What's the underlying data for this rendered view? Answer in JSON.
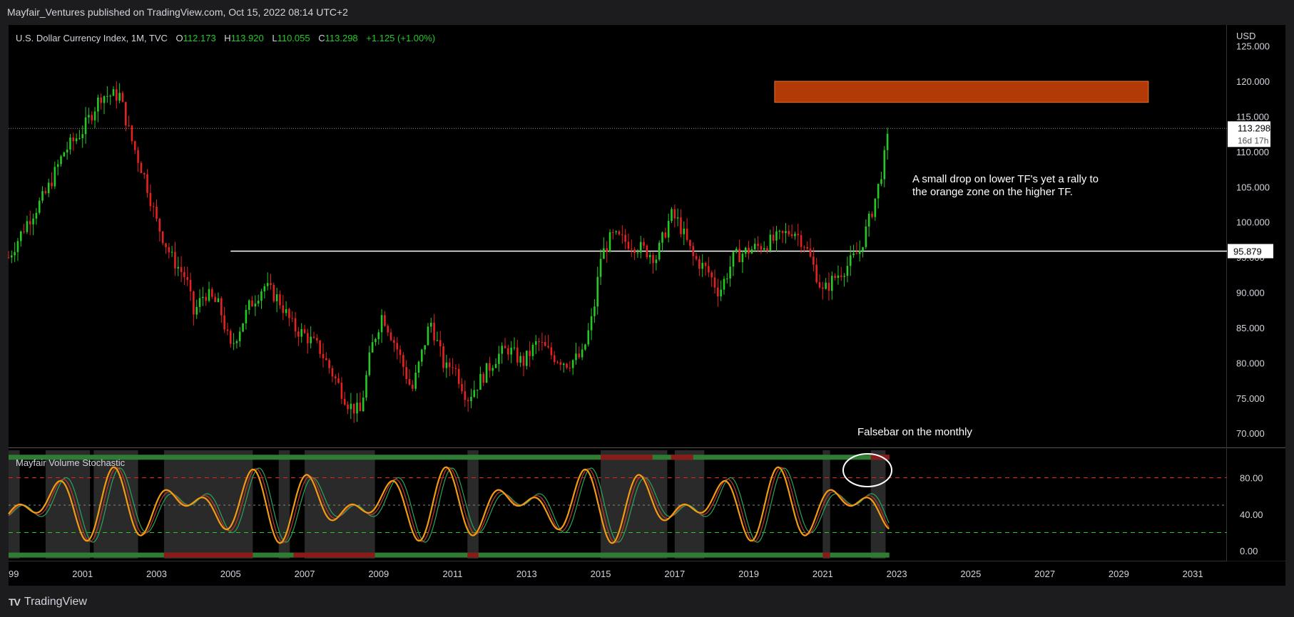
{
  "header": {
    "published": "Mayfair_Ventures published on TradingView.com, Oct 15, 2022 08:14 UTC+2"
  },
  "footer": {
    "brand": "TradingView",
    "logo": "tv-logo"
  },
  "symbol": {
    "name": "U.S. Dollar Currency Index, 1M, TVC",
    "o_label": "O",
    "o": "112.173",
    "h_label": "H",
    "h": "113.920",
    "l_label": "L",
    "l": "110.055",
    "c_label": "C",
    "c": "113.298",
    "change": "+1.125 (+1.00%)"
  },
  "price_axis": {
    "currency": "USD"
  },
  "annotations": {
    "note_line1": "A small drop on lower TF's yet a rally to",
    "note_line2": "the orange zone on the higher TF.",
    "falsebar": "Falsebar on the monthly",
    "level": "95.879",
    "last_price": "113.298",
    "countdown": "16d 17h"
  },
  "indicator": {
    "name": "Mayfair Volume Stochastic"
  },
  "colors": {
    "up": "#26c826",
    "down": "#e52222",
    "zone": "#b23a06",
    "stoch_fast": "#26a65b",
    "stoch_slow": "#c0392b",
    "stoch_ma": "#f39c12"
  },
  "chart_data": [
    {
      "type": "candlestick",
      "title": "U.S. Dollar Currency Index, 1M, TVC",
      "x_ticks": [
        "99",
        "2001",
        "2003",
        "2005",
        "2007",
        "2009",
        "2011",
        "2013",
        "2015",
        "2017",
        "2019",
        "2021",
        "2023",
        "2025",
        "2027",
        "2029",
        "2031"
      ],
      "y_ticks": [
        "125.000",
        "120.000",
        "115.000",
        "110.000",
        "105.000",
        "100.000",
        "95.000",
        "90.000",
        "85.000",
        "80.000",
        "75.000",
        "70.000"
      ],
      "ylim": [
        68,
        128
      ],
      "close_path": [
        [
          1999.0,
          95
        ],
        [
          1999.5,
          100
        ],
        [
          2000.0,
          104
        ],
        [
          2000.5,
          110
        ],
        [
          2001.0,
          113
        ],
        [
          2001.5,
          118
        ],
        [
          2002.0,
          118
        ],
        [
          2002.3,
          112
        ],
        [
          2002.7,
          106
        ],
        [
          2003.0,
          100
        ],
        [
          2003.4,
          95
        ],
        [
          2003.8,
          92
        ],
        [
          2004.0,
          87
        ],
        [
          2004.3,
          90
        ],
        [
          2004.7,
          88
        ],
        [
          2005.0,
          82
        ],
        [
          2005.5,
          88
        ],
        [
          2005.9,
          91
        ],
        [
          2006.3,
          89
        ],
        [
          2006.7,
          85
        ],
        [
          2007.0,
          84
        ],
        [
          2007.4,
          82
        ],
        [
          2007.8,
          78
        ],
        [
          2008.2,
          74
        ],
        [
          2008.5,
          73
        ],
        [
          2008.8,
          82
        ],
        [
          2009.1,
          87
        ],
        [
          2009.5,
          82
        ],
        [
          2009.9,
          76
        ],
        [
          2010.4,
          86
        ],
        [
          2010.8,
          79
        ],
        [
          2011.0,
          80
        ],
        [
          2011.4,
          75
        ],
        [
          2011.8,
          78
        ],
        [
          2012.2,
          81
        ],
        [
          2012.5,
          82
        ],
        [
          2012.9,
          80
        ],
        [
          2013.3,
          83
        ],
        [
          2013.7,
          81
        ],
        [
          2014.1,
          80
        ],
        [
          2014.5,
          81
        ],
        [
          2014.8,
          87
        ],
        [
          2015.0,
          95
        ],
        [
          2015.3,
          98
        ],
        [
          2015.8,
          97
        ],
        [
          2016.2,
          96
        ],
        [
          2016.5,
          95
        ],
        [
          2016.9,
          101
        ],
        [
          2017.1,
          100
        ],
        [
          2017.5,
          95
        ],
        [
          2017.9,
          93
        ],
        [
          2018.2,
          90
        ],
        [
          2018.6,
          95
        ],
        [
          2019.0,
          96
        ],
        [
          2019.5,
          97
        ],
        [
          2019.9,
          98
        ],
        [
          2020.2,
          99
        ],
        [
          2020.5,
          97
        ],
        [
          2020.8,
          93
        ],
        [
          2021.0,
          90
        ],
        [
          2021.3,
          92
        ],
        [
          2021.7,
          94
        ],
        [
          2022.0,
          96
        ],
        [
          2022.3,
          101
        ],
        [
          2022.5,
          105
        ],
        [
          2022.7,
          110
        ],
        [
          2022.8,
          113.3
        ]
      ],
      "horizontal_level": 95.879,
      "last_price": 113.298,
      "zone": {
        "x": [
          2019.7,
          2029.8
        ],
        "y": [
          117,
          120
        ]
      }
    },
    {
      "type": "line",
      "title": "Mayfair Volume Stochastic",
      "y_ticks": [
        "80.00",
        "40.00",
        "0.00"
      ],
      "ylim": [
        -10,
        110
      ],
      "levels": {
        "upper_dashed": 80,
        "middle_dotted": 50,
        "lower_dashed": 20
      }
    }
  ]
}
